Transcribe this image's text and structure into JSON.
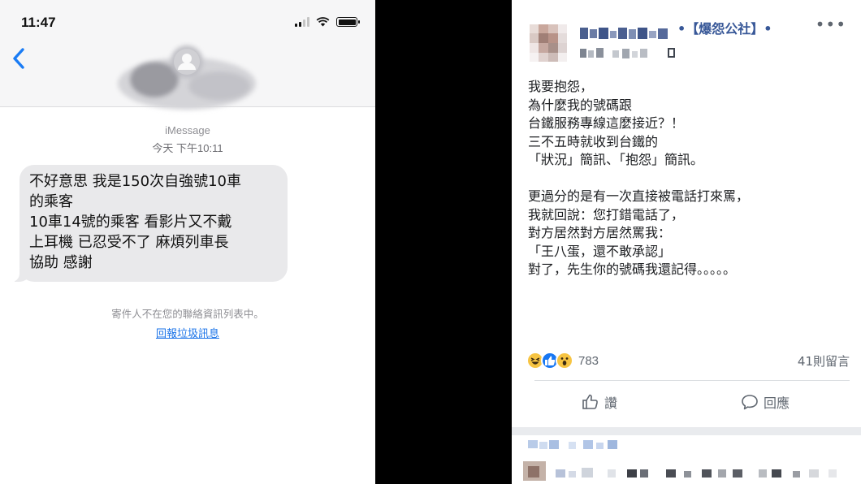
{
  "phone": {
    "status_time": "11:47",
    "message_service": "iMessage",
    "timestamp": "今天 下午10:11",
    "message_lines": [
      "不好意思 我是150次自強號10車",
      "的乘客",
      "10車14號的乘客 看影片又不戴",
      "上耳機 已忍受不了 麻煩列車長",
      "協助 感謝"
    ],
    "unknown_sender_notice": "寄件人不在您的聯絡資訊列表中。",
    "report_junk_link": "回報垃圾訊息",
    "accent_color": "#1a73e8",
    "bubble_color": "#e9e9eb"
  },
  "facebook": {
    "group_name": "•【爆怨公社】•",
    "more_icon": "more-dots-icon",
    "post_lines": [
      "我要抱怨，",
      "為什麼我的號碼跟",
      "台鐵服務專線這麼接近？！",
      "三不五時就收到台鐵的",
      "「狀況」簡訊、「抱怨」簡訊。",
      "",
      "更過分的是有一次直接被電話打來罵，",
      "我就回說：您打錯電話了，",
      "對方居然對方居然罵我：",
      "「王八蛋，還不敢承認」",
      "對了，先生你的號碼我還記得。。。。。"
    ],
    "reaction_icons": [
      "haha-icon",
      "like-icon",
      "wow-icon"
    ],
    "reaction_count": "783",
    "comment_count": "41則留言",
    "like_button": "讚",
    "comment_button": "回應",
    "link_color": "#385898"
  }
}
